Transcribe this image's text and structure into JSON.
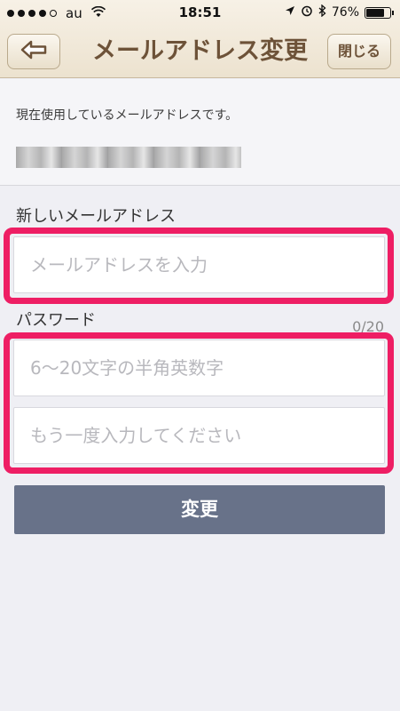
{
  "status_bar": {
    "carrier": "au",
    "time": "18:51",
    "battery": "76%",
    "battery_level": 0.76,
    "signal_bars": 4
  },
  "nav": {
    "back_icon": "arrow-left-icon",
    "title": "メールアドレス変更",
    "close_label": "閉じる"
  },
  "current": {
    "label": "現在使用しているメールアドレスです。"
  },
  "new_email": {
    "label": "新しいメールアドレス",
    "placeholder": "メールアドレスを入力"
  },
  "password": {
    "label": "パスワード",
    "counter": "0/20",
    "placeholder": "6〜20文字の半角英数字",
    "confirm_placeholder": "もう一度入力してください"
  },
  "submit": {
    "label": "変更"
  },
  "colors": {
    "highlight": "#ee1e64",
    "button": "#687289",
    "nav_text": "#6d5238"
  }
}
